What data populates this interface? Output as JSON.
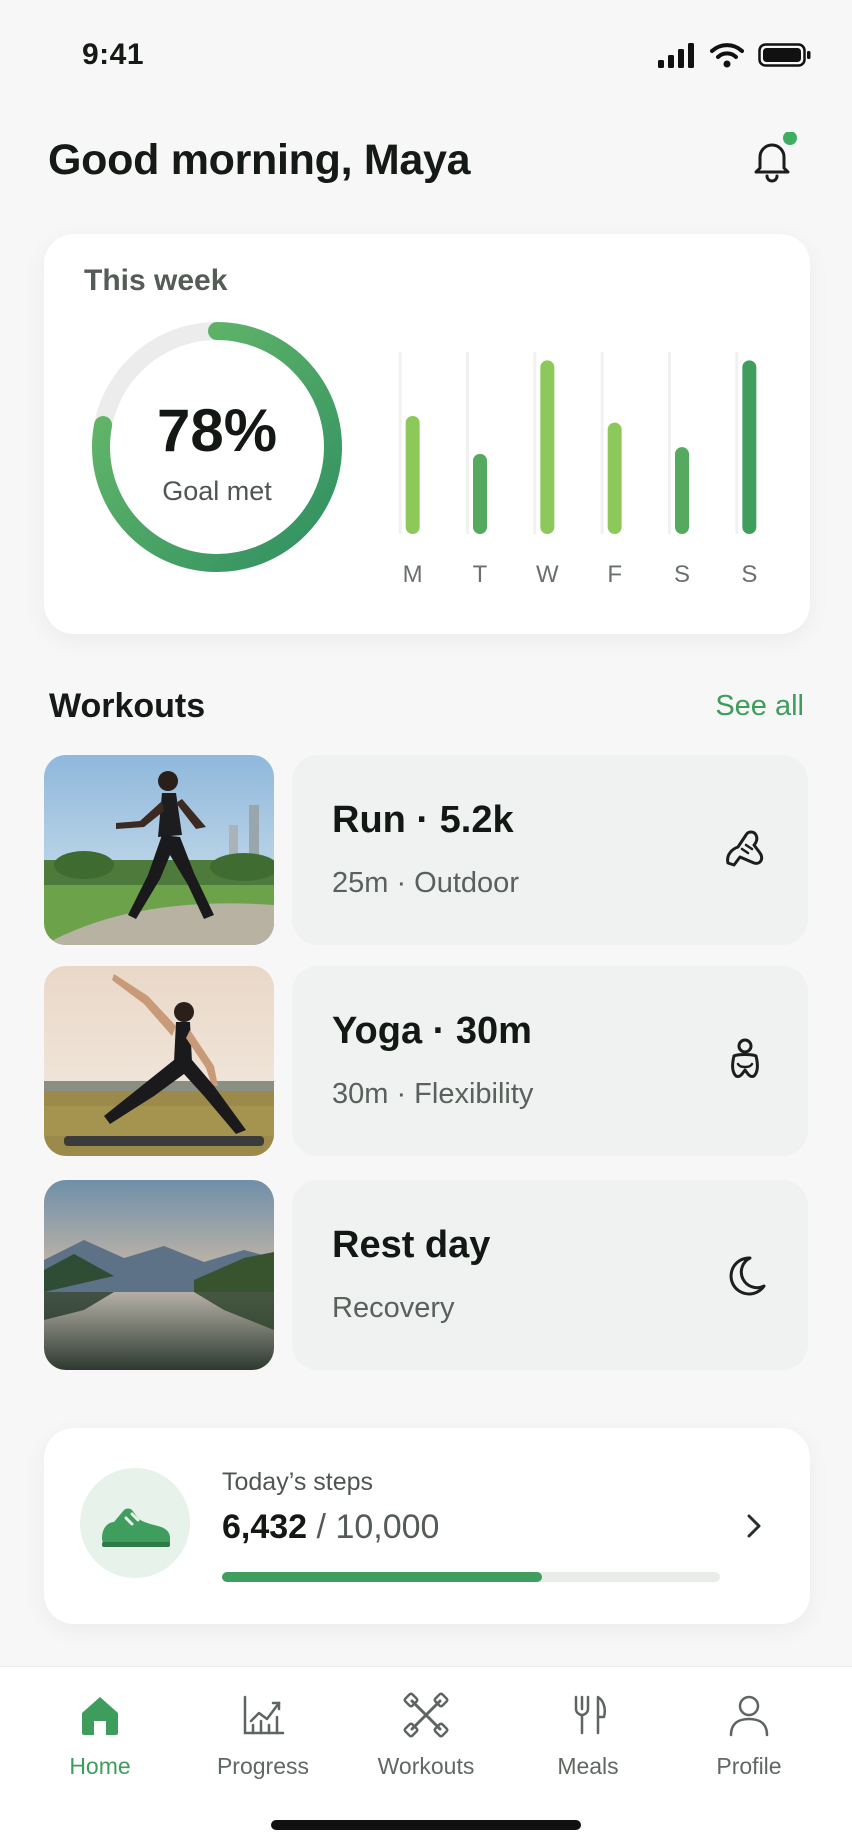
{
  "status_bar": {
    "time": "9:41"
  },
  "header": {
    "greeting": "Good morning, Maya"
  },
  "week_card": {
    "label": "This week",
    "goal_percent_text": "78%",
    "goal_caption": "Goal met",
    "goal_fraction": 0.78,
    "days": [
      {
        "label": "M",
        "level": 0.53
      },
      {
        "label": "T",
        "level": 0.36
      },
      {
        "label": "W",
        "level": 0.78
      },
      {
        "label": "F",
        "level": 0.5
      },
      {
        "label": "S",
        "level": 0.39
      },
      {
        "label": "S",
        "level": 0.78
      }
    ]
  },
  "workouts": {
    "title": "Workouts",
    "see_all": "See all",
    "items": [
      {
        "title": "Run · 5.2k",
        "subtitle": "25m · Outdoor",
        "icon": "shoe-icon",
        "photo": "runner-photo"
      },
      {
        "title": "Yoga · 30m",
        "subtitle": "30m · Flexibility",
        "icon": "yoga-person-icon",
        "photo": "yoga-photo"
      },
      {
        "title": "Rest day",
        "subtitle": "Recovery",
        "icon": "moon-icon",
        "photo": "lake-photo"
      }
    ]
  },
  "steps": {
    "label": "Today’s steps",
    "current": "6,432",
    "goal": "/ 10,000",
    "progress": 0.6432
  },
  "tabs": [
    {
      "label": "Home",
      "icon": "home-icon",
      "active": true
    },
    {
      "label": "Progress",
      "icon": "chart-icon",
      "active": false
    },
    {
      "label": "Workouts",
      "icon": "dumbbell-icon",
      "active": false
    },
    {
      "label": "Meals",
      "icon": "utensils-icon",
      "active": false
    },
    {
      "label": "Profile",
      "icon": "person-icon",
      "active": false
    }
  ],
  "colors": {
    "accent": "#3e9d5c",
    "bar_light": "#8dc95a",
    "bar_dark": "#3f9d5e",
    "card_bg": "#ffffff",
    "workout_card_bg": "#eff2f0"
  }
}
